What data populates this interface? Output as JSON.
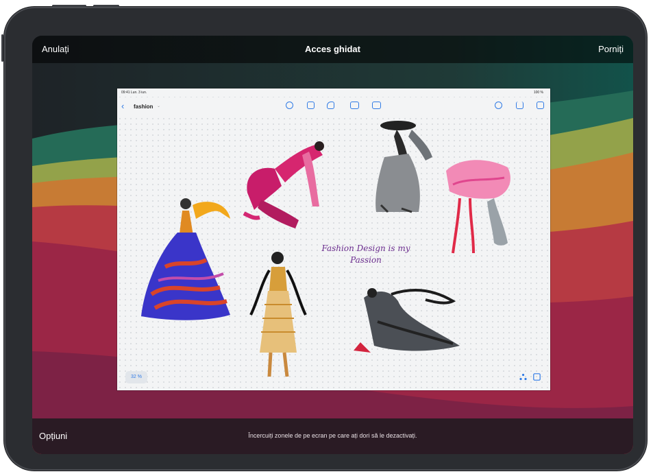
{
  "guided_access": {
    "cancel_label": "Anulați",
    "title": "Acces ghidat",
    "start_label": "Porniți",
    "options_label": "Opțiuni",
    "instruction": "Încercuiți zonele de pe ecran pe care ați dori să le dezactivați."
  },
  "app": {
    "status_time": "09:41  Lun. 3 iun.",
    "battery": "100 %",
    "doc_title": "fashion",
    "caption_line1": "Fashion Design is my",
    "caption_line2": "Passion",
    "zoom": "32 %"
  },
  "icons": {
    "back": "chevron-left-icon",
    "toolbar": [
      "pen-icon",
      "text-box-icon",
      "shapes-icon",
      "add-text-icon",
      "image-icon"
    ],
    "right_toolbar": [
      "collaboration-icon",
      "share-icon",
      "compose-icon"
    ],
    "bottom_right": [
      "connect-icon",
      "grid-icon"
    ]
  },
  "colors": {
    "accent": "#2f7ae5",
    "caption": "#6b2d8e"
  }
}
